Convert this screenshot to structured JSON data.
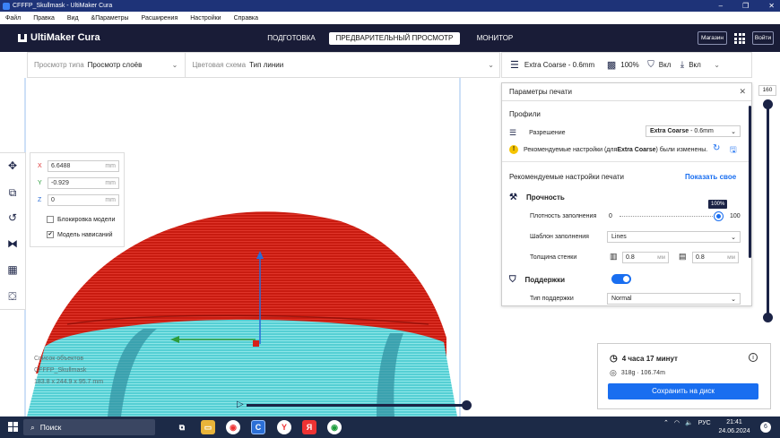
{
  "window": {
    "title": "CFFFP_Skullmask - UltiMaker Cura",
    "controls": [
      "–",
      "❐",
      "✕"
    ]
  },
  "menu": [
    "Файл",
    "Правка",
    "Вид",
    "&Параметры",
    "Расширения",
    "Настройки",
    "Справка"
  ],
  "header": {
    "logo": "UltiMaker Cura",
    "stages": {
      "prepare": "ПОДГОТОВКА",
      "preview": "ПРЕДВАРИТЕЛЬНЫЙ ПРОСМОТР",
      "monitor": "МОНИТОР"
    },
    "marketplace": "Магазин",
    "login": "Войти"
  },
  "viewbar": {
    "view_type_label": "Просмотр типа",
    "view_type_value": "Просмотр слоёв",
    "color_scheme_label": "Цветовая схема",
    "color_scheme_value": "Тип линии"
  },
  "settingsbar": {
    "profile": "Extra Coarse - 0.6mm",
    "infill": "100%",
    "support": "Вкл",
    "adhesion": "Вкл"
  },
  "move_panel": {
    "x_label": "X",
    "x_value": "6.6488",
    "y_label": "Y",
    "y_value": "-0.929",
    "z_label": "Z",
    "z_value": "0",
    "unit": "mm",
    "lock_model": "Блокировка модели",
    "drop_model": "Модель нависаний",
    "lock_checked": false,
    "drop_checked": true
  },
  "print_panel": {
    "title": "Параметры печати",
    "profiles_heading": "Профили",
    "resolution_label": "Разрешение",
    "resolution_value_bold": "Extra Coarse",
    "resolution_value_rest": " - 0.6mm",
    "warning_pre": "Рекомендуемые настройки (для ",
    "warning_bold": "Extra Coarse",
    "warning_post": ") были изменены.",
    "recommended_heading": "Рекомендуемые настройки печати",
    "show_custom": "Показать свое",
    "strength_heading": "Прочность",
    "infill_density_label": "Плотность заполнения",
    "infill_min": "0",
    "infill_max": "100",
    "infill_tooltip": "100%",
    "infill_value": 100,
    "infill_pattern_label": "Шаблон заполнения",
    "infill_pattern_value": "Lines",
    "wall_thickness_label": "Толщина стенки",
    "wall_value": "0.8",
    "topbottom_value": "0.8",
    "unit": "мм",
    "support_heading": "Поддержки",
    "support_enabled": true,
    "support_type_label": "Тип поддержки",
    "support_type_value": "Normal"
  },
  "layer_slider": {
    "max_layer": "160"
  },
  "object_list": {
    "header": "Список объектов",
    "name": "CFFFP_Skullmask",
    "dims": "183.8 x 244.9 x 95.7 mm"
  },
  "estimate": {
    "time": "4 часа 17 минут",
    "material": "318g · 106.74m",
    "save": "Сохранить на диск"
  },
  "taskbar": {
    "search": "Поиск",
    "lang": "РУС",
    "time": "21:41",
    "date": "24.06.2024",
    "notifications": "6"
  },
  "colors": {
    "header_bg": "#191c37",
    "titlebar_bg": "#1e3378",
    "accent": "#196ef0",
    "model_red": "#cc1f12",
    "support_cyan": "#5fd4d8",
    "taskbar_bg": "#1c2a47"
  }
}
